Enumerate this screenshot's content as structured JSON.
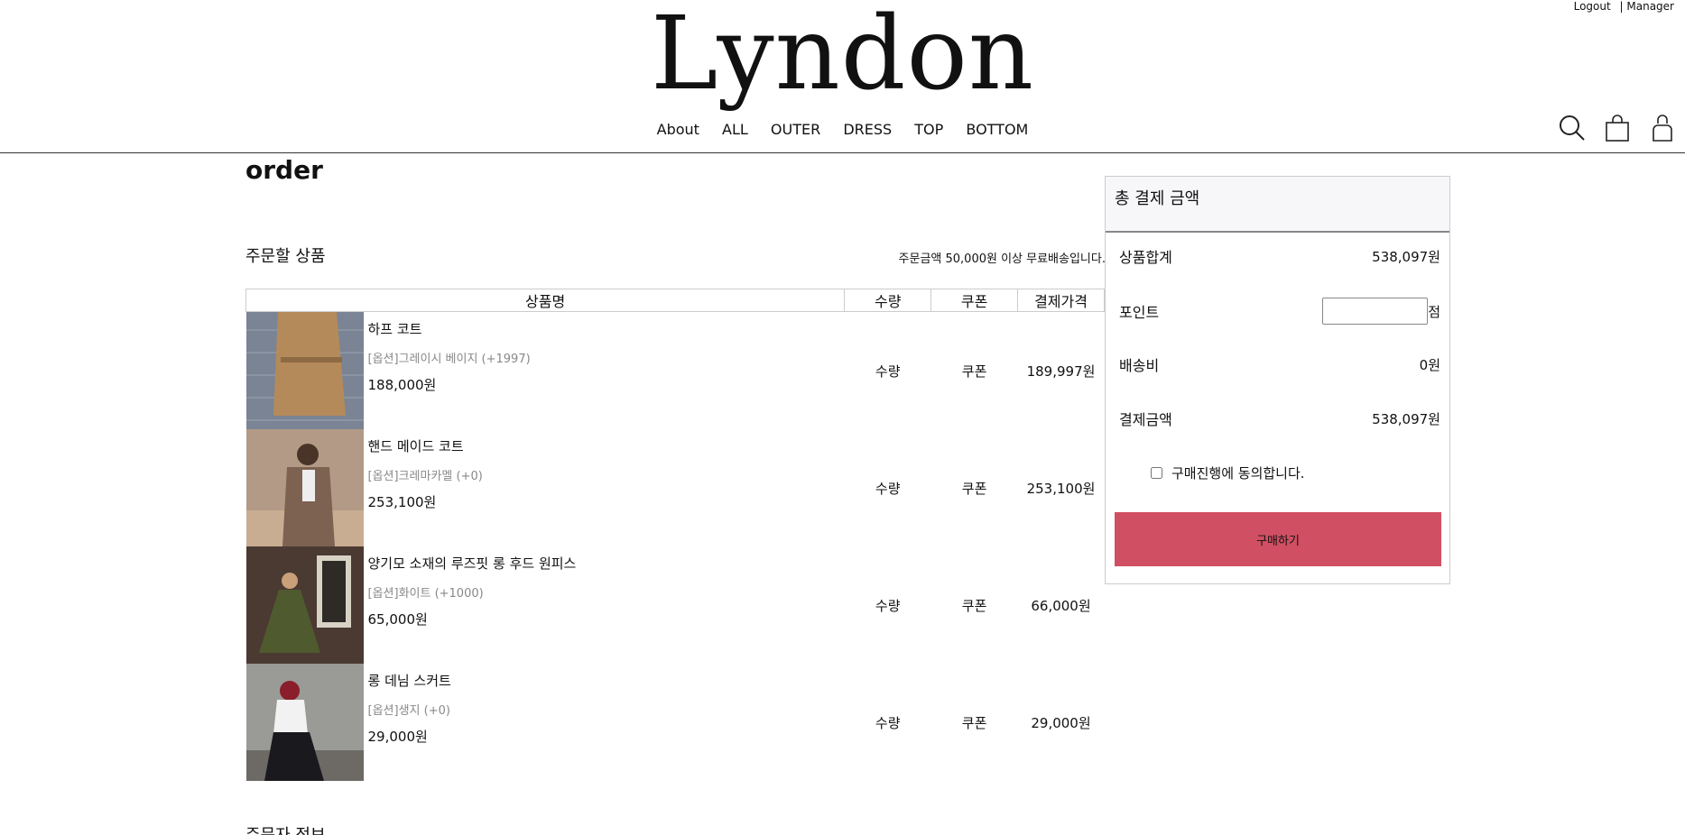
{
  "header": {
    "logout_label": "Logout",
    "manager_label": "| Manager",
    "logo": "Lyndon",
    "nav": [
      "About",
      "ALL",
      "OUTER",
      "DRESS",
      "TOP",
      "BOTTOM"
    ],
    "icons": [
      "search-icon",
      "shopping-bag-icon",
      "user-icon"
    ]
  },
  "page": {
    "title": "order",
    "section_title": "주문할 상품",
    "shipping_note": "주문금액 50,000원 이상 무료배송입니다.",
    "next_section_title": "주문자 정보"
  },
  "table": {
    "headers": [
      "상품명",
      "수량",
      "쿠폰",
      "결제가격"
    ],
    "rows": [
      {
        "name": "하프 코트",
        "option": "[옵션]그레이시 베이지 (+1997)",
        "price": "188,000원",
        "qty": "수량",
        "coupon": "쿠폰",
        "total": "189,997원"
      },
      {
        "name": "핸드 메이드 코트",
        "option": "[옵션]크레마카멜 (+0)",
        "price": "253,100원",
        "qty": "수량",
        "coupon": "쿠폰",
        "total": "253,100원"
      },
      {
        "name": "양기모 소재의 루즈핏 롱 후드 원피스",
        "option": "[옵션]화이트 (+1000)",
        "price": "65,000원",
        "qty": "수량",
        "coupon": "쿠폰",
        "total": "66,000원"
      },
      {
        "name": "롱 데님 스커트",
        "option": "[옵션]생지 (+0)",
        "price": "29,000원",
        "qty": "수량",
        "coupon": "쿠폰",
        "total": "29,000원"
      }
    ]
  },
  "summary": {
    "title": "총 결제 금액",
    "subtotal_label": "상품합계",
    "subtotal_value": "538,097원",
    "point_label": "포인트",
    "point_unit": "점",
    "shipping_label": "배송비",
    "shipping_value": "0원",
    "total_label": "결제금액",
    "total_value": "538,097원",
    "agree_label": "구매진행에 동의합니다.",
    "buy_label": "구매하기"
  },
  "colors": {
    "buy_button": "#d14f62",
    "summary_header": "#f7f7f9"
  }
}
